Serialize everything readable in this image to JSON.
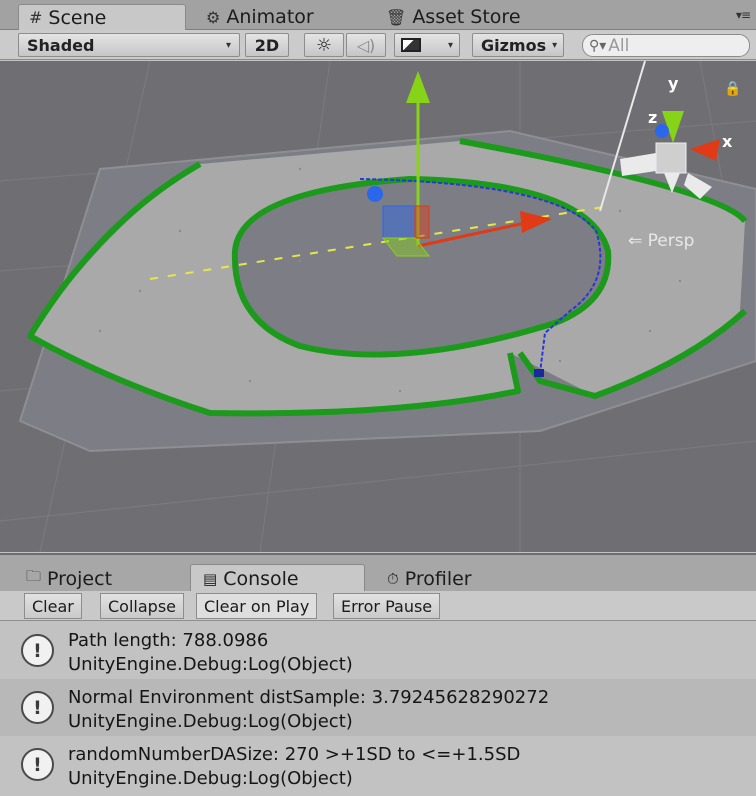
{
  "tabs": {
    "scene": "Scene",
    "animator": "Animator",
    "asset_store": "Asset Store"
  },
  "toolbar": {
    "draw_mode": "Shaded",
    "mode_2d": "2D",
    "gizmos": "Gizmos",
    "search_placeholder": "All"
  },
  "scene": {
    "camera_label": "Persp",
    "axes": {
      "x": "x",
      "y": "y",
      "z": "z"
    },
    "colors": {
      "ground": "#6f6f73",
      "track": "#a9a9a9",
      "border": "#1b9a1b",
      "path": "#2a36d6",
      "x_axis": "#e03a16",
      "y_axis": "#86d317",
      "z_axis": "#2a67ea"
    }
  },
  "bottom_tabs": {
    "project": "Project",
    "console": "Console",
    "profiler": "Profiler"
  },
  "console_toolbar": {
    "clear": "Clear",
    "collapse": "Collapse",
    "clear_on_play": "Clear on Play",
    "error_pause": "Error Pause"
  },
  "console": {
    "entries": [
      {
        "message": "Path length: 788.0986",
        "stack": "UnityEngine.Debug:Log(Object)"
      },
      {
        "message": "Normal Environment distSample: 3.79245628290272",
        "stack": "UnityEngine.Debug:Log(Object)"
      },
      {
        "message": "randomNumberDASize: 270 >+1SD to <=+1.5SD",
        "stack": "UnityEngine.Debug:Log(Object)"
      }
    ]
  }
}
